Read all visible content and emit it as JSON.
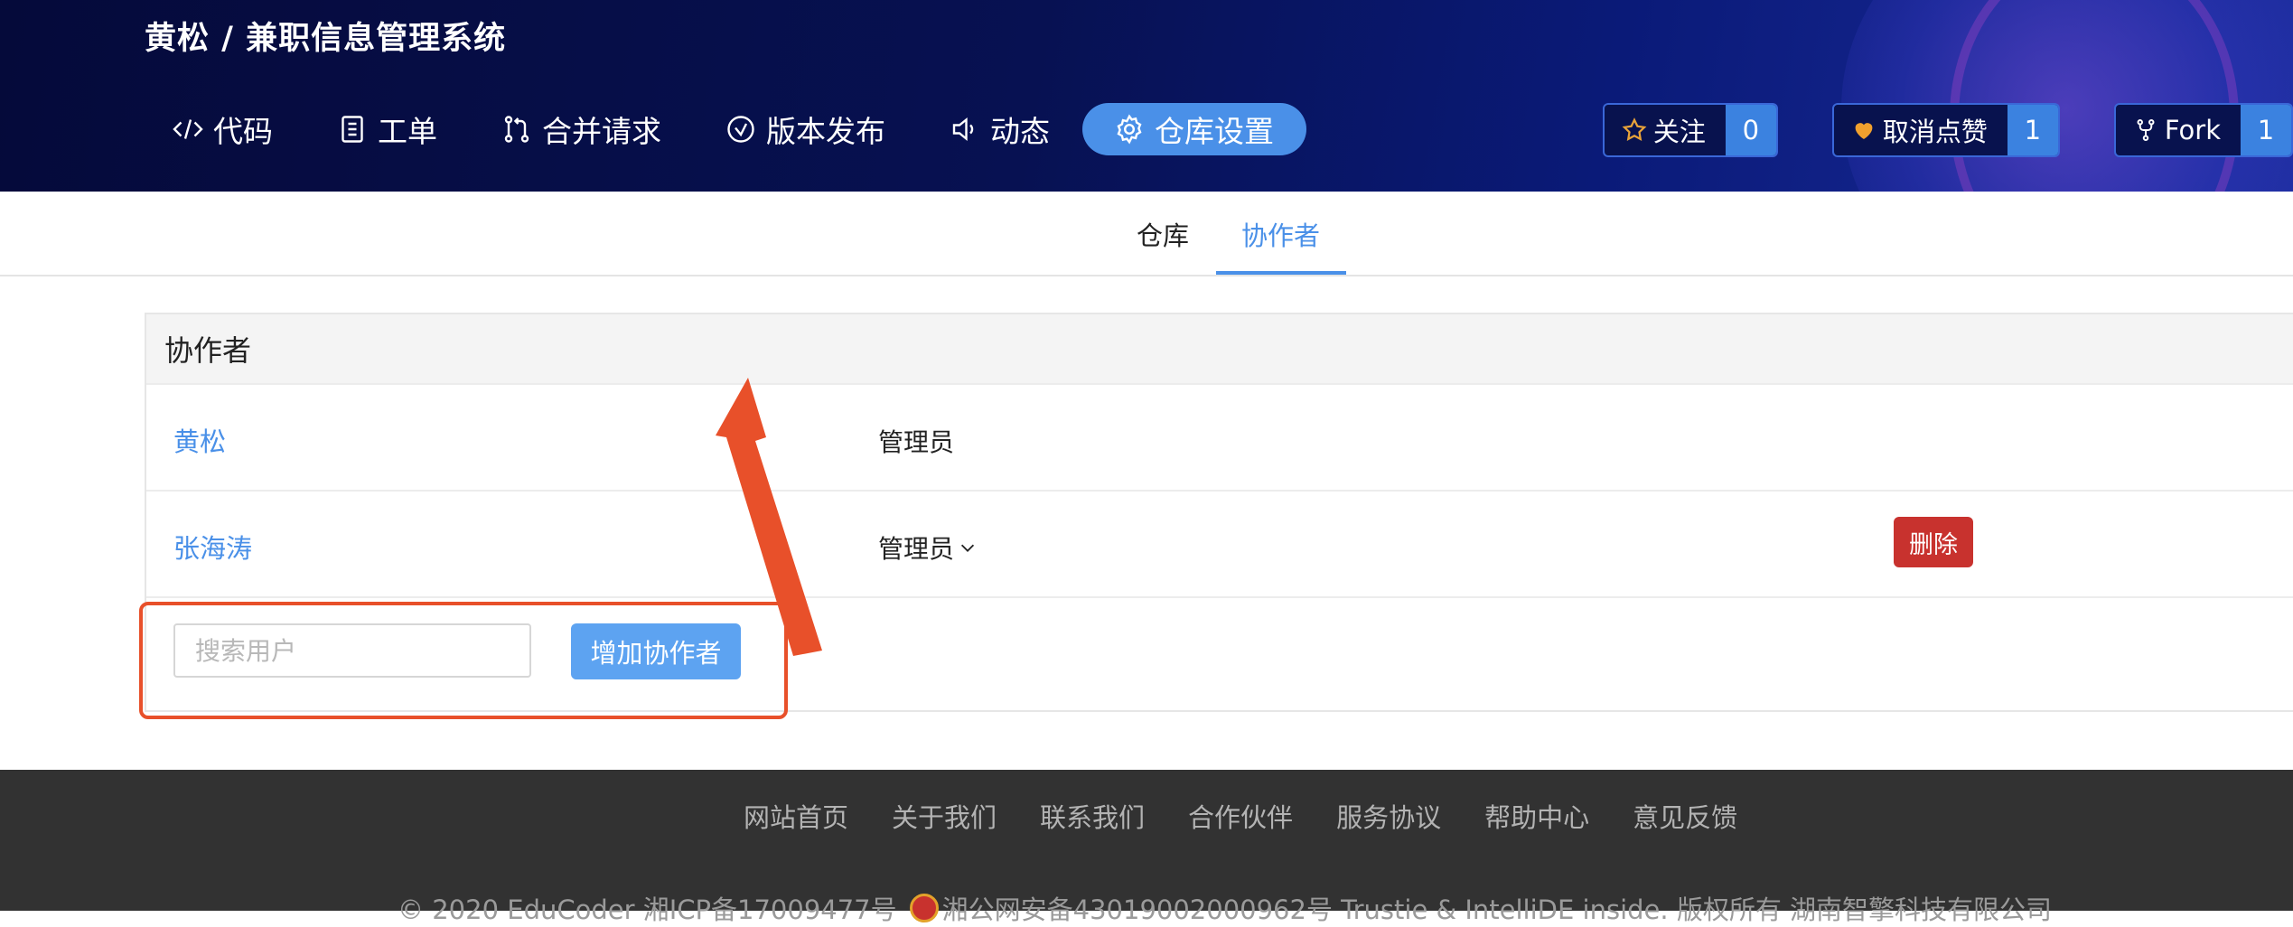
{
  "header": {
    "repo_title": "黄松 / 兼职信息管理系统",
    "nav": [
      {
        "label": "代码",
        "icon": "code-icon"
      },
      {
        "label": "工单",
        "icon": "clipboard-icon"
      },
      {
        "label": "合并请求",
        "icon": "merge-icon"
      },
      {
        "label": "版本发布",
        "icon": "check-circle-icon"
      },
      {
        "label": "动态",
        "icon": "speaker-icon"
      },
      {
        "label": "仓库设置",
        "icon": "gear-icon",
        "active": true
      }
    ],
    "actions": {
      "watch": {
        "label": "关注",
        "count": "0"
      },
      "like": {
        "label": "取消点赞",
        "count": "1"
      },
      "fork": {
        "label": "Fork",
        "count": "1"
      }
    }
  },
  "subtabs": [
    {
      "label": "仓库",
      "active": false
    },
    {
      "label": "协作者",
      "active": true
    }
  ],
  "panel": {
    "title": "协作者",
    "collaborators": [
      {
        "name": "黄松",
        "role": "管理员",
        "editable": false
      },
      {
        "name": "张海涛",
        "role": "管理员",
        "editable": true,
        "delete_label": "删除"
      }
    ],
    "search_placeholder": "搜索用户",
    "add_label": "增加协作者"
  },
  "footer": {
    "links": [
      "网站首页",
      "关于我们",
      "联系我们",
      "合作伙伴",
      "服务协议",
      "帮助中心",
      "意见反馈"
    ],
    "copyright_left": "© 2020 EduCoder   湘ICP备17009477号",
    "copyright_right": "湘公网安备43019002000962号   Trustie   &   IntelliDE inside. 版权所有 湖南智擎科技有限公司"
  },
  "colors": {
    "accent": "#4a90e8",
    "danger": "#c8322e",
    "annotation": "#e8502a",
    "header_bg": "#071152",
    "footer_bg": "#323232"
  }
}
